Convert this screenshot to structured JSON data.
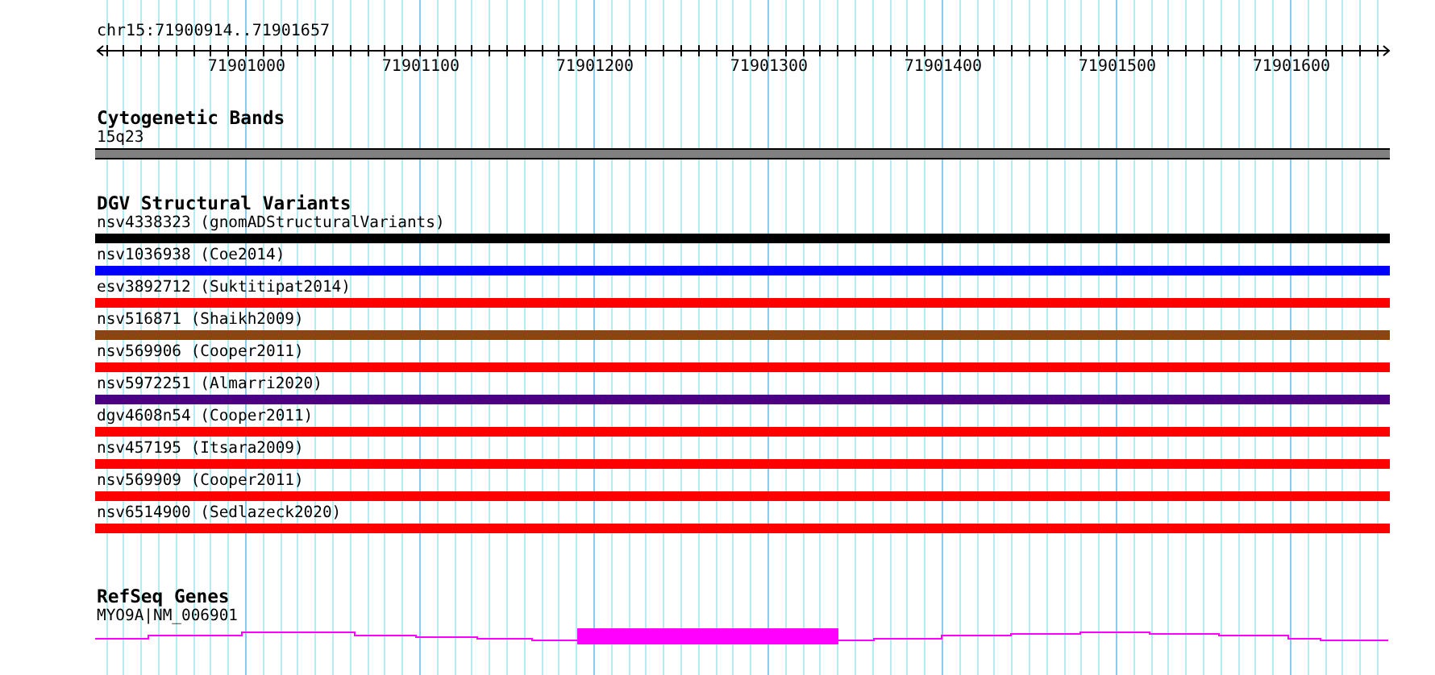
{
  "ruler": {
    "location": "chr15:71900914..71901657",
    "tick_labels": [
      "71901000",
      "71901100",
      "71901200",
      "71901300",
      "71901400",
      "71901500",
      "71901600"
    ]
  },
  "tracks": [
    {
      "kind": "bands",
      "title": "Cytogenetic Bands",
      "features": [
        {
          "label": "15q23"
        }
      ]
    },
    {
      "kind": "variants",
      "title": "DGV Structural Variants",
      "features": [
        {
          "label": "nsv4338323 (gnomADStructuralVariants)",
          "color": "#000000"
        },
        {
          "label": "nsv1036938 (Coe2014)",
          "color": "#0000ff"
        },
        {
          "label": "esv3892712 (Suktitipat2014)",
          "color": "#ff0000"
        },
        {
          "label": "nsv516871 (Shaikh2009)",
          "color": "#8b4513"
        },
        {
          "label": "nsv569906 (Cooper2011)",
          "color": "#ff0000"
        },
        {
          "label": "nsv5972251 (Almarri2020)",
          "color": "#4b0082"
        },
        {
          "label": "dgv4608n54 (Cooper2011)",
          "color": "#ff0000"
        },
        {
          "label": "nsv457195 (Itsara2009)",
          "color": "#ff0000"
        },
        {
          "label": "nsv569909 (Cooper2011)",
          "color": "#ff0000"
        },
        {
          "label": "nsv6514900 (Sedlazeck2020)",
          "color": "#ff0000"
        }
      ]
    },
    {
      "kind": "genes",
      "title": "RefSeq Genes",
      "features": [
        {
          "label": "MYO9A|NM_006901"
        }
      ]
    }
  ]
}
